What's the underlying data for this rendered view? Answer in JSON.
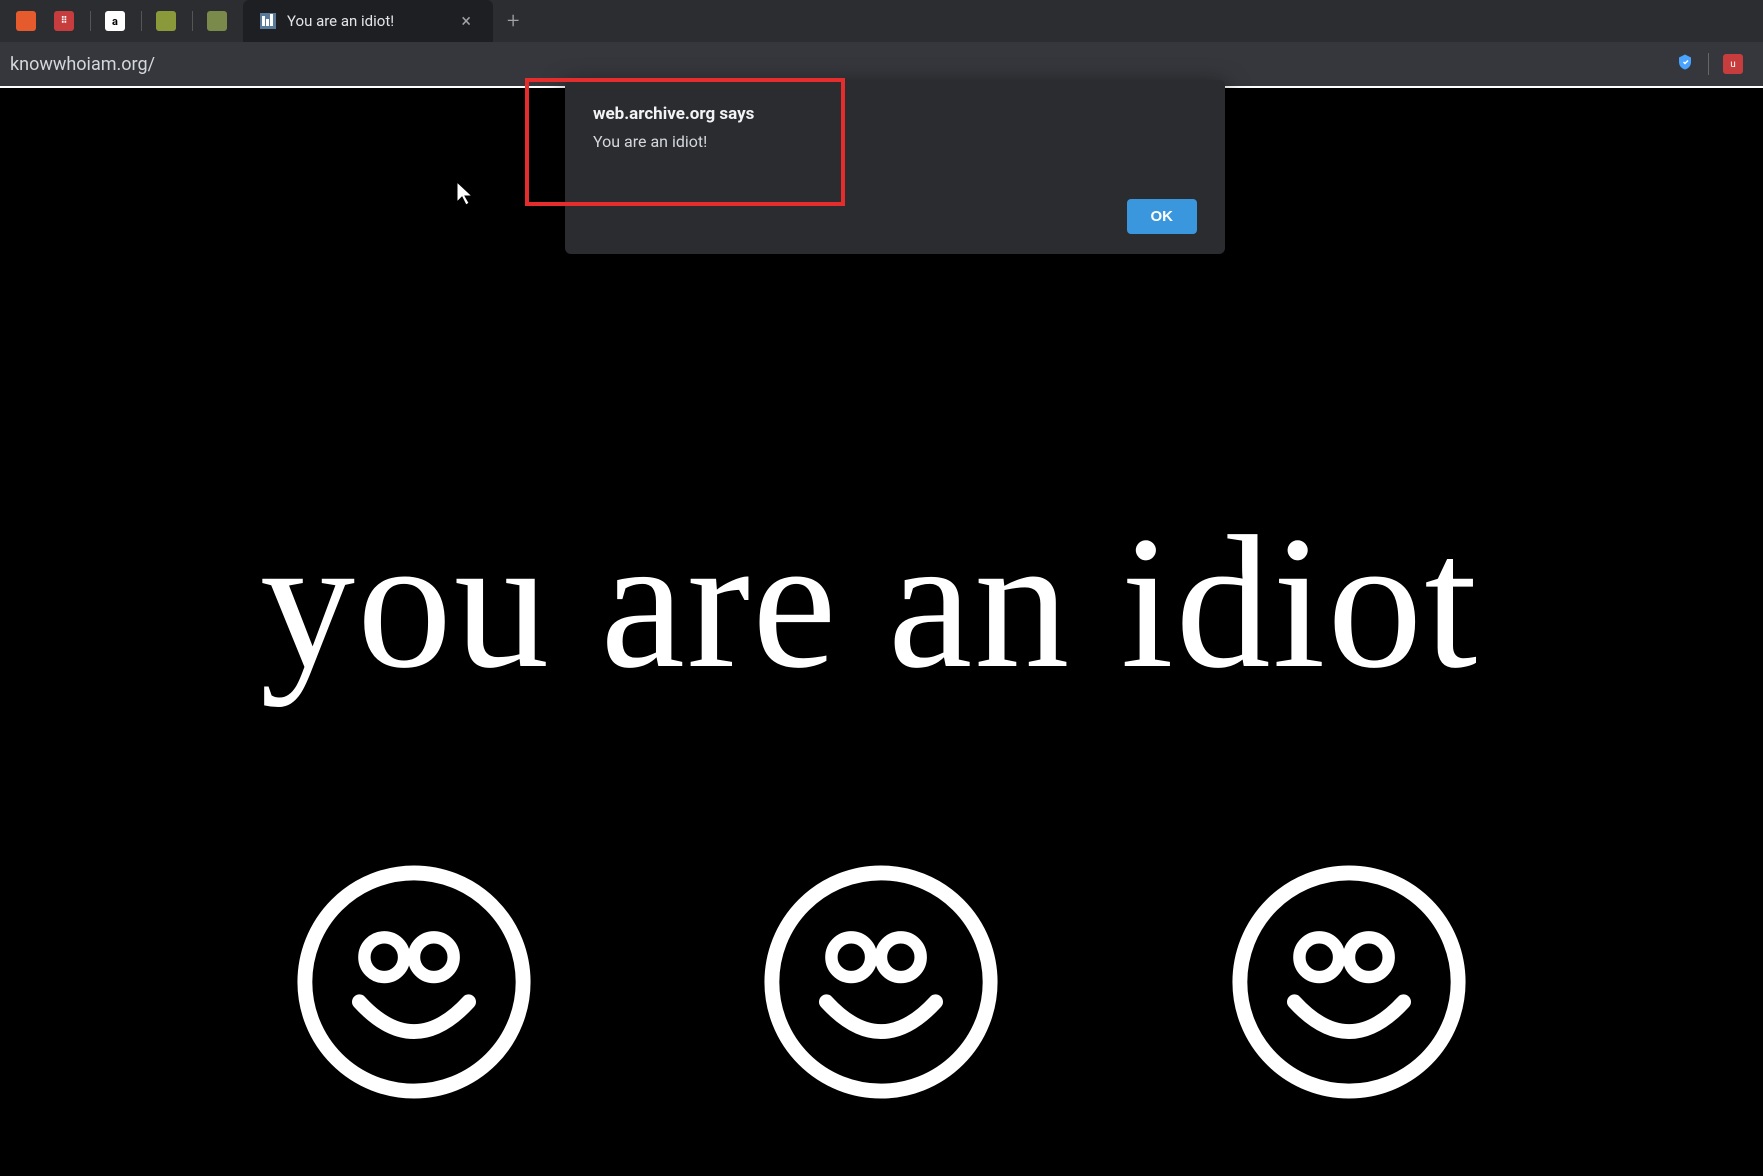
{
  "browser": {
    "pinned_tabs": [
      {
        "name": "chart-icon",
        "color_class": "icon-orange",
        "glyph": ""
      },
      {
        "name": "grid-icon",
        "color_class": "icon-red",
        "glyph": "⠿"
      },
      {
        "name": "amazon-icon",
        "color_class": "icon-white",
        "glyph": "a"
      },
      {
        "name": "wiki-icon",
        "color_class": "icon-green",
        "glyph": ""
      },
      {
        "name": "wiki2-icon",
        "color_class": "icon-green2",
        "glyph": ""
      }
    ],
    "active_tab": {
      "title": "You are an idiot!"
    },
    "url": "knowwhoiam.org/",
    "new_tab_glyph": "+",
    "close_glyph": "×"
  },
  "alert": {
    "title": "web.archive.org says",
    "message": "You are an idiot!",
    "ok_label": "OK"
  },
  "page": {
    "main_text": "you are an idiot",
    "smiley_count": 3
  },
  "highlight": {
    "color": "#e52d2d"
  }
}
